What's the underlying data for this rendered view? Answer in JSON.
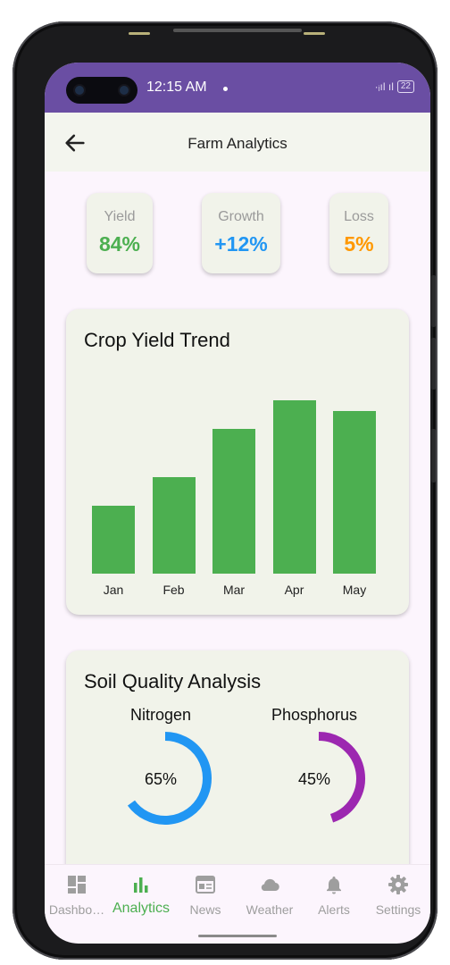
{
  "status_bar": {
    "time": "12:15 AM",
    "signal": "·ᵢıl ıl",
    "battery": "22"
  },
  "app_bar": {
    "title": "Farm Analytics",
    "back_icon": "arrow-left-icon"
  },
  "stats": [
    {
      "label": "Yield",
      "value": "84%",
      "color": "#4caf50"
    },
    {
      "label": "Growth",
      "value": "+12%",
      "color": "#2196f3"
    },
    {
      "label": "Loss",
      "value": "5%",
      "color": "#ff9800"
    }
  ],
  "crop_chart": {
    "title": "Crop Yield Trend",
    "chart_data": {
      "type": "bar",
      "categories": [
        "Jan",
        "Feb",
        "Mar",
        "Apr",
        "May"
      ],
      "values": [
        38,
        54,
        81,
        97,
        91
      ],
      "ylim": [
        0,
        100
      ],
      "color": "#4caf50",
      "grid": false
    }
  },
  "soil": {
    "title": "Soil Quality Analysis",
    "gauges": [
      {
        "label": "Nitrogen",
        "value_text": "65%",
        "fraction": 0.65,
        "color": "#2196f3"
      },
      {
        "label": "Phosphorus",
        "value_text": "45%",
        "fraction": 0.45,
        "color": "#9c27b0"
      }
    ]
  },
  "nav": {
    "items": [
      {
        "label": "Dashbo…",
        "icon": "dashboard-icon",
        "active": false
      },
      {
        "label": "Analytics",
        "icon": "bar-chart-icon",
        "active": true
      },
      {
        "label": "News",
        "icon": "newspaper-icon",
        "active": false
      },
      {
        "label": "Weather",
        "icon": "cloud-icon",
        "active": false
      },
      {
        "label": "Alerts",
        "icon": "bell-icon",
        "active": false
      },
      {
        "label": "Settings",
        "icon": "gear-icon",
        "active": false
      }
    ],
    "active_color": "#4caf50",
    "inactive_color": "#9e9e9e"
  }
}
